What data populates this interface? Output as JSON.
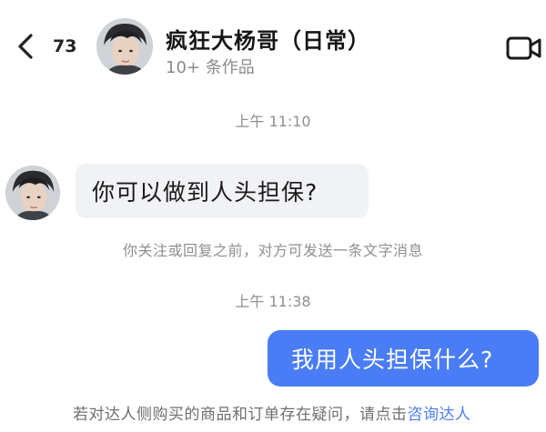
{
  "header": {
    "back_icon": "chevron-left-icon",
    "unread_count": "73",
    "contact_name": "疯狂大杨哥（日常）",
    "works_count": "10+ 条作品",
    "video_call_icon": "video-camera-icon"
  },
  "messages": [
    {
      "type": "timestamp",
      "text": "上午 11:10"
    },
    {
      "type": "incoming",
      "text": "你可以做到人头担保?"
    },
    {
      "type": "system",
      "text": "你关注或回复之前，对方可发送一条文字消息"
    },
    {
      "type": "timestamp",
      "text": "上午 11:38"
    },
    {
      "type": "outgoing",
      "text": "我用人头担保什么?"
    }
  ],
  "footer": {
    "notice_text": "若对达人侧购买的商品和订单存在疑问，请点击",
    "notice_link": "咨询达人"
  },
  "colors": {
    "accent": "#4a7df5",
    "incoming_bubble": "#f1f2f5",
    "muted_text": "#8f8f8f"
  }
}
